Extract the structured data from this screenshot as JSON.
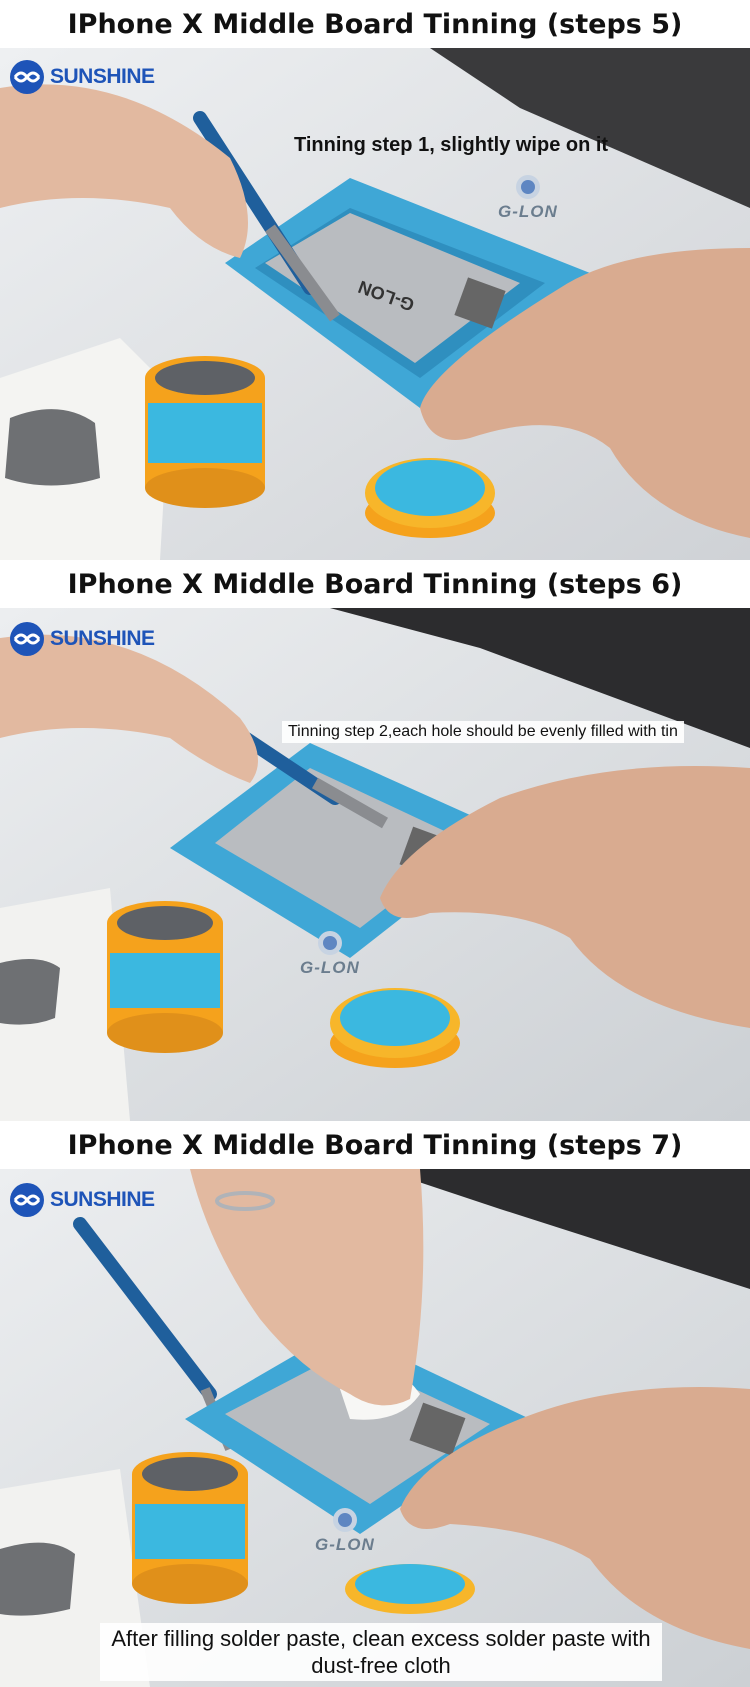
{
  "sections": [
    {
      "title": "IPhone X Middle Board Tinning (steps 5)",
      "caption": "Tinning step 1, slightly wipe on it",
      "brand": "SUNSHINE",
      "watermark": "G-LON"
    },
    {
      "title": "IPhone X Middle Board Tinning (steps 6)",
      "caption": "Tinning step 2,each hole should be evenly filled with tin",
      "brand": "SUNSHINE",
      "watermark": "G-LON"
    },
    {
      "title": "IPhone X Middle Board Tinning (steps 7)",
      "caption": "After filling solder paste, clean excess solder paste with dust-free cloth",
      "brand": "SUNSHINE",
      "watermark": "G-LON"
    }
  ],
  "stencil_label": "G-LON",
  "colors": {
    "fixture_blue": "#3fa7d6",
    "brand_blue": "#1e54b8",
    "jar_orange": "#f5a21c",
    "label_cyan": "#3bb8e0",
    "skin": "#e2b9a0",
    "stencil": "#b9bcc0",
    "paste": "#5e6166"
  },
  "icons": [
    "sunshine-logo-icon",
    "glon-logo-icon"
  ]
}
